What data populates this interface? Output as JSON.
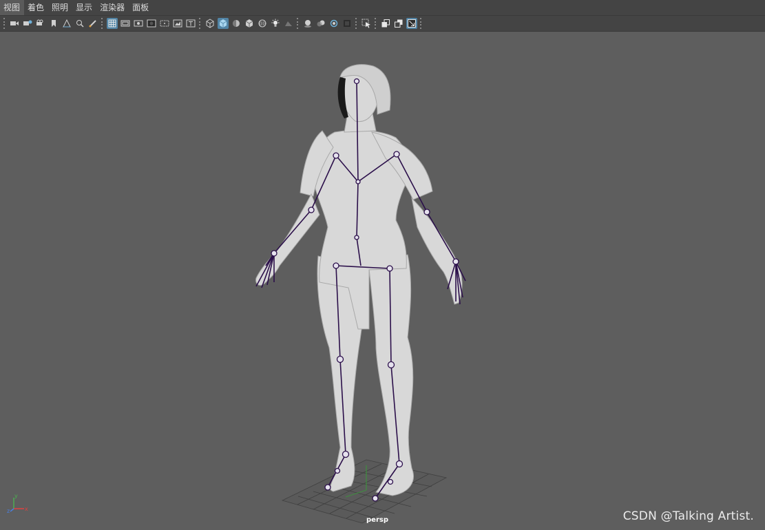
{
  "menu": {
    "items": [
      {
        "label": "视图"
      },
      {
        "label": "着色"
      },
      {
        "label": "照明"
      },
      {
        "label": "显示"
      },
      {
        "label": "渲染器"
      },
      {
        "label": "面板"
      }
    ]
  },
  "toolbar": {
    "groups": [
      [
        "camera-icon",
        "camera-attributes-icon",
        "camera-lock-icon",
        "bookmark-icon",
        "image-plane-icon",
        "two-d-pan-icon",
        "grease-pencil-icon"
      ],
      [
        "grid-icon",
        "film-gate-icon",
        "resolution-gate-icon",
        "gate-mask-icon",
        "field-chart-icon",
        "safe-action-icon",
        "safe-title-icon"
      ],
      [
        "wireframe-icon",
        "smooth-shade-icon",
        "default-material-icon",
        "textured-icon",
        "xray-icon",
        "use-default-lighting-icon",
        "shadows-icon"
      ],
      [
        "ambient-occlusion-icon",
        "motion-blur-icon",
        "anti-aliasing-icon",
        "depth-of-field-icon"
      ],
      [
        "isolate-select-icon"
      ],
      [
        "xray-joints-icon",
        "xray-active-icon",
        "toggle-hud-icon"
      ]
    ],
    "active_icons": [
      "grid-icon",
      "smooth-shade-icon",
      "toggle-hud-icon"
    ]
  },
  "viewport": {
    "camera_label": "persp",
    "background_color": "#5e5e5e",
    "joint_color": "#2b0f4a",
    "mesh_color": "#d9d9d9",
    "axis_labels": {
      "x": "x",
      "y": "y",
      "z": "z"
    }
  },
  "watermark": "CSDN @Talking Artist."
}
